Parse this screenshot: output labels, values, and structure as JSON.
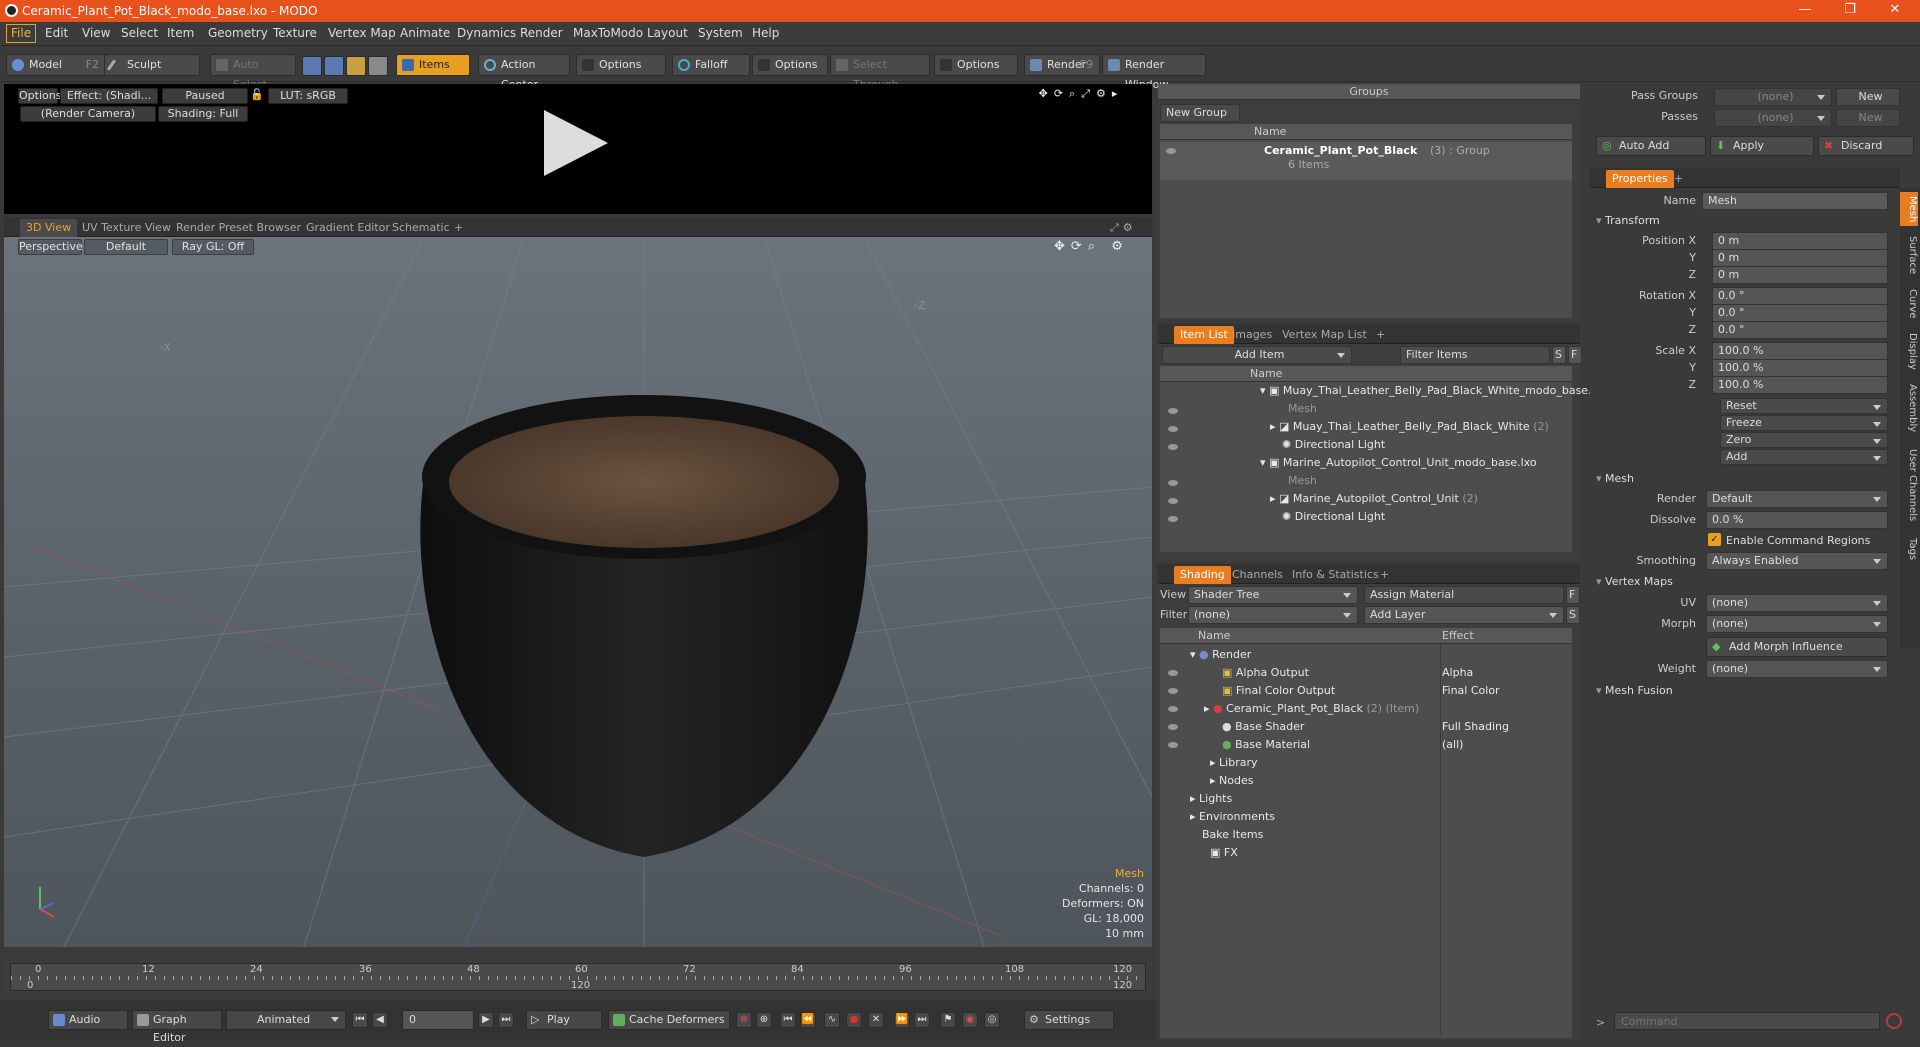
{
  "window": {
    "title": "Ceramic_Plant_Pot_Black_modo_base.lxo - MODO",
    "min": "—",
    "max": "❐",
    "close": "✕"
  },
  "menu": [
    "File",
    "Edit",
    "View",
    "Select",
    "Item",
    "Geometry",
    "Texture",
    "Vertex Map",
    "Animate",
    "Dynamics",
    "Render",
    "MaxToModo",
    "Layout",
    "System",
    "Help"
  ],
  "toolbar": {
    "model": "Model",
    "model_key": "F2",
    "sculpt": "Sculpt",
    "auto_select": "Auto Select",
    "items": "Items",
    "action_center": "Action Center",
    "options1": "Options",
    "falloff": "Falloff",
    "options2": "Options",
    "select_through": "Select Through",
    "options3": "Options",
    "render": "Render",
    "render_key": "F9",
    "render_window": "Render Window"
  },
  "preview": {
    "options": "Options",
    "effect": "Effect: (Shadi...",
    "paused": "Paused",
    "lut": "LUT: sRGB",
    "camera": "(Render Camera)",
    "shading": "Shading: Full"
  },
  "view_tabs": [
    "3D View",
    "UV Texture View",
    "Render Preset Browser",
    "Gradient Editor",
    "Schematic",
    "+"
  ],
  "viewport": {
    "projection": "Perspective",
    "style": "Default",
    "raygl": "Ray GL: Off",
    "axis_x": "-X",
    "axis_z": "-Z",
    "info_title": "Mesh",
    "channels": "Channels: 0",
    "deformers": "Deformers: ON",
    "gl": "GL: 18,000",
    "scale": "10 mm"
  },
  "timeline": {
    "ticks": [
      "0",
      "12",
      "24",
      "36",
      "48",
      "60",
      "72",
      "84",
      "96",
      "108",
      "120"
    ],
    "start": "0",
    "mid": "120",
    "end": "120"
  },
  "bottom": {
    "audio": "Audio",
    "graph_editor": "Graph Editor",
    "animated": "Animated",
    "frame": "0",
    "play": "Play",
    "cache": "Cache Deformers",
    "settings": "Settings"
  },
  "groups": {
    "title": "Groups",
    "new_group": "New Group",
    "col_name": "Name",
    "item_name": "Ceramic_Plant_Pot_Black",
    "item_count": "(3)",
    "item_type": ": Group",
    "item_sub": "6 Items"
  },
  "itemlist": {
    "tabs": [
      "Item List",
      "Images",
      "Vertex Map List",
      "+"
    ],
    "add_item": "Add Item",
    "filter": "Filter Items",
    "s": "S",
    "f": "F",
    "col_name": "Name",
    "rows": [
      {
        "text": "Muay_Thai_Leather_Belly_Pad_Black_White_modo_base.lxo",
        "extra": ""
      },
      {
        "text": "Mesh",
        "extra": ""
      },
      {
        "text": "Muay_Thai_Leather_Belly_Pad_Black_White",
        "extra": "(2)"
      },
      {
        "text": "Directional Light",
        "extra": ""
      },
      {
        "text": "Marine_Autopilot_Control_Unit_modo_base.lxo",
        "extra": ""
      },
      {
        "text": "Mesh",
        "extra": ""
      },
      {
        "text": "Marine_Autopilot_Control_Unit",
        "extra": "(2)"
      },
      {
        "text": "Directional Light",
        "extra": ""
      }
    ]
  },
  "shading": {
    "tabs": [
      "Shading",
      "Channels",
      "Info & Statistics",
      "+"
    ],
    "view_label": "View",
    "view_value": "Shader Tree",
    "assign": "Assign Material",
    "f": "F",
    "filter_label": "Filter",
    "filter_value": "(none)",
    "add_layer": "Add Layer",
    "s": "S",
    "col_name": "Name",
    "col_effect": "Effect",
    "rows": [
      {
        "name": "Render",
        "effect": "",
        "extra": ""
      },
      {
        "name": "Alpha Output",
        "effect": "Alpha",
        "extra": ""
      },
      {
        "name": "Final Color Output",
        "effect": "Final Color",
        "extra": ""
      },
      {
        "name": "Ceramic_Plant_Pot_Black",
        "effect": "",
        "extra": "(2) (Item)"
      },
      {
        "name": "Base Shader",
        "effect": "Full Shading",
        "extra": ""
      },
      {
        "name": "Base Material",
        "effect": "(all)",
        "extra": ""
      },
      {
        "name": "Library",
        "effect": "",
        "extra": ""
      },
      {
        "name": "Nodes",
        "effect": "",
        "extra": ""
      },
      {
        "name": "Lights",
        "effect": "",
        "extra": ""
      },
      {
        "name": "Environments",
        "effect": "",
        "extra": ""
      },
      {
        "name": "Bake Items",
        "effect": "",
        "extra": ""
      },
      {
        "name": "FX",
        "effect": "",
        "extra": ""
      }
    ]
  },
  "passes": {
    "pass_groups": "Pass Groups",
    "passes": "Passes",
    "none": "(none)",
    "new": "New",
    "auto_add": "Auto Add",
    "apply": "Apply",
    "discard": "Discard"
  },
  "properties": {
    "tab": "Properties",
    "plus": "+",
    "name_label": "Name",
    "name_value": "Mesh",
    "transform": "Transform",
    "position_x": "Position X",
    "rotation_x": "Rotation X",
    "scale_x": "Scale X",
    "y": "Y",
    "z": "Z",
    "pos": [
      "0 m",
      "0 m",
      "0 m"
    ],
    "rot": [
      "0.0 °",
      "0.0 °",
      "0.0 °"
    ],
    "scl": [
      "100.0 %",
      "100.0 %",
      "100.0 %"
    ],
    "reset": "Reset",
    "freeze": "Freeze",
    "zero": "Zero",
    "add": "Add",
    "mesh": "Mesh",
    "render_label": "Render",
    "render_value": "Default",
    "dissolve_label": "Dissolve",
    "dissolve_value": "0.0 %",
    "enable_cmd": "Enable Command Regions",
    "smoothing_label": "Smoothing",
    "smoothing_value": "Always Enabled",
    "vertex_maps": "Vertex Maps",
    "uv_label": "UV",
    "uv_value": "(none)",
    "morph_label": "Morph",
    "morph_value": "(none)",
    "add_morph": "Add Morph Influence",
    "weight_label": "Weight",
    "weight_value": "(none)",
    "mesh_fusion": "Mesh Fusion",
    "side_tabs": [
      "Mesh",
      "Surface",
      "Curve",
      "Display",
      "Assembly",
      "User Channels",
      "Tags"
    ]
  },
  "command": {
    "placeholder": "Command"
  },
  "colors": {
    "accent": "#e8501c",
    "highlight": "#f0a030"
  }
}
